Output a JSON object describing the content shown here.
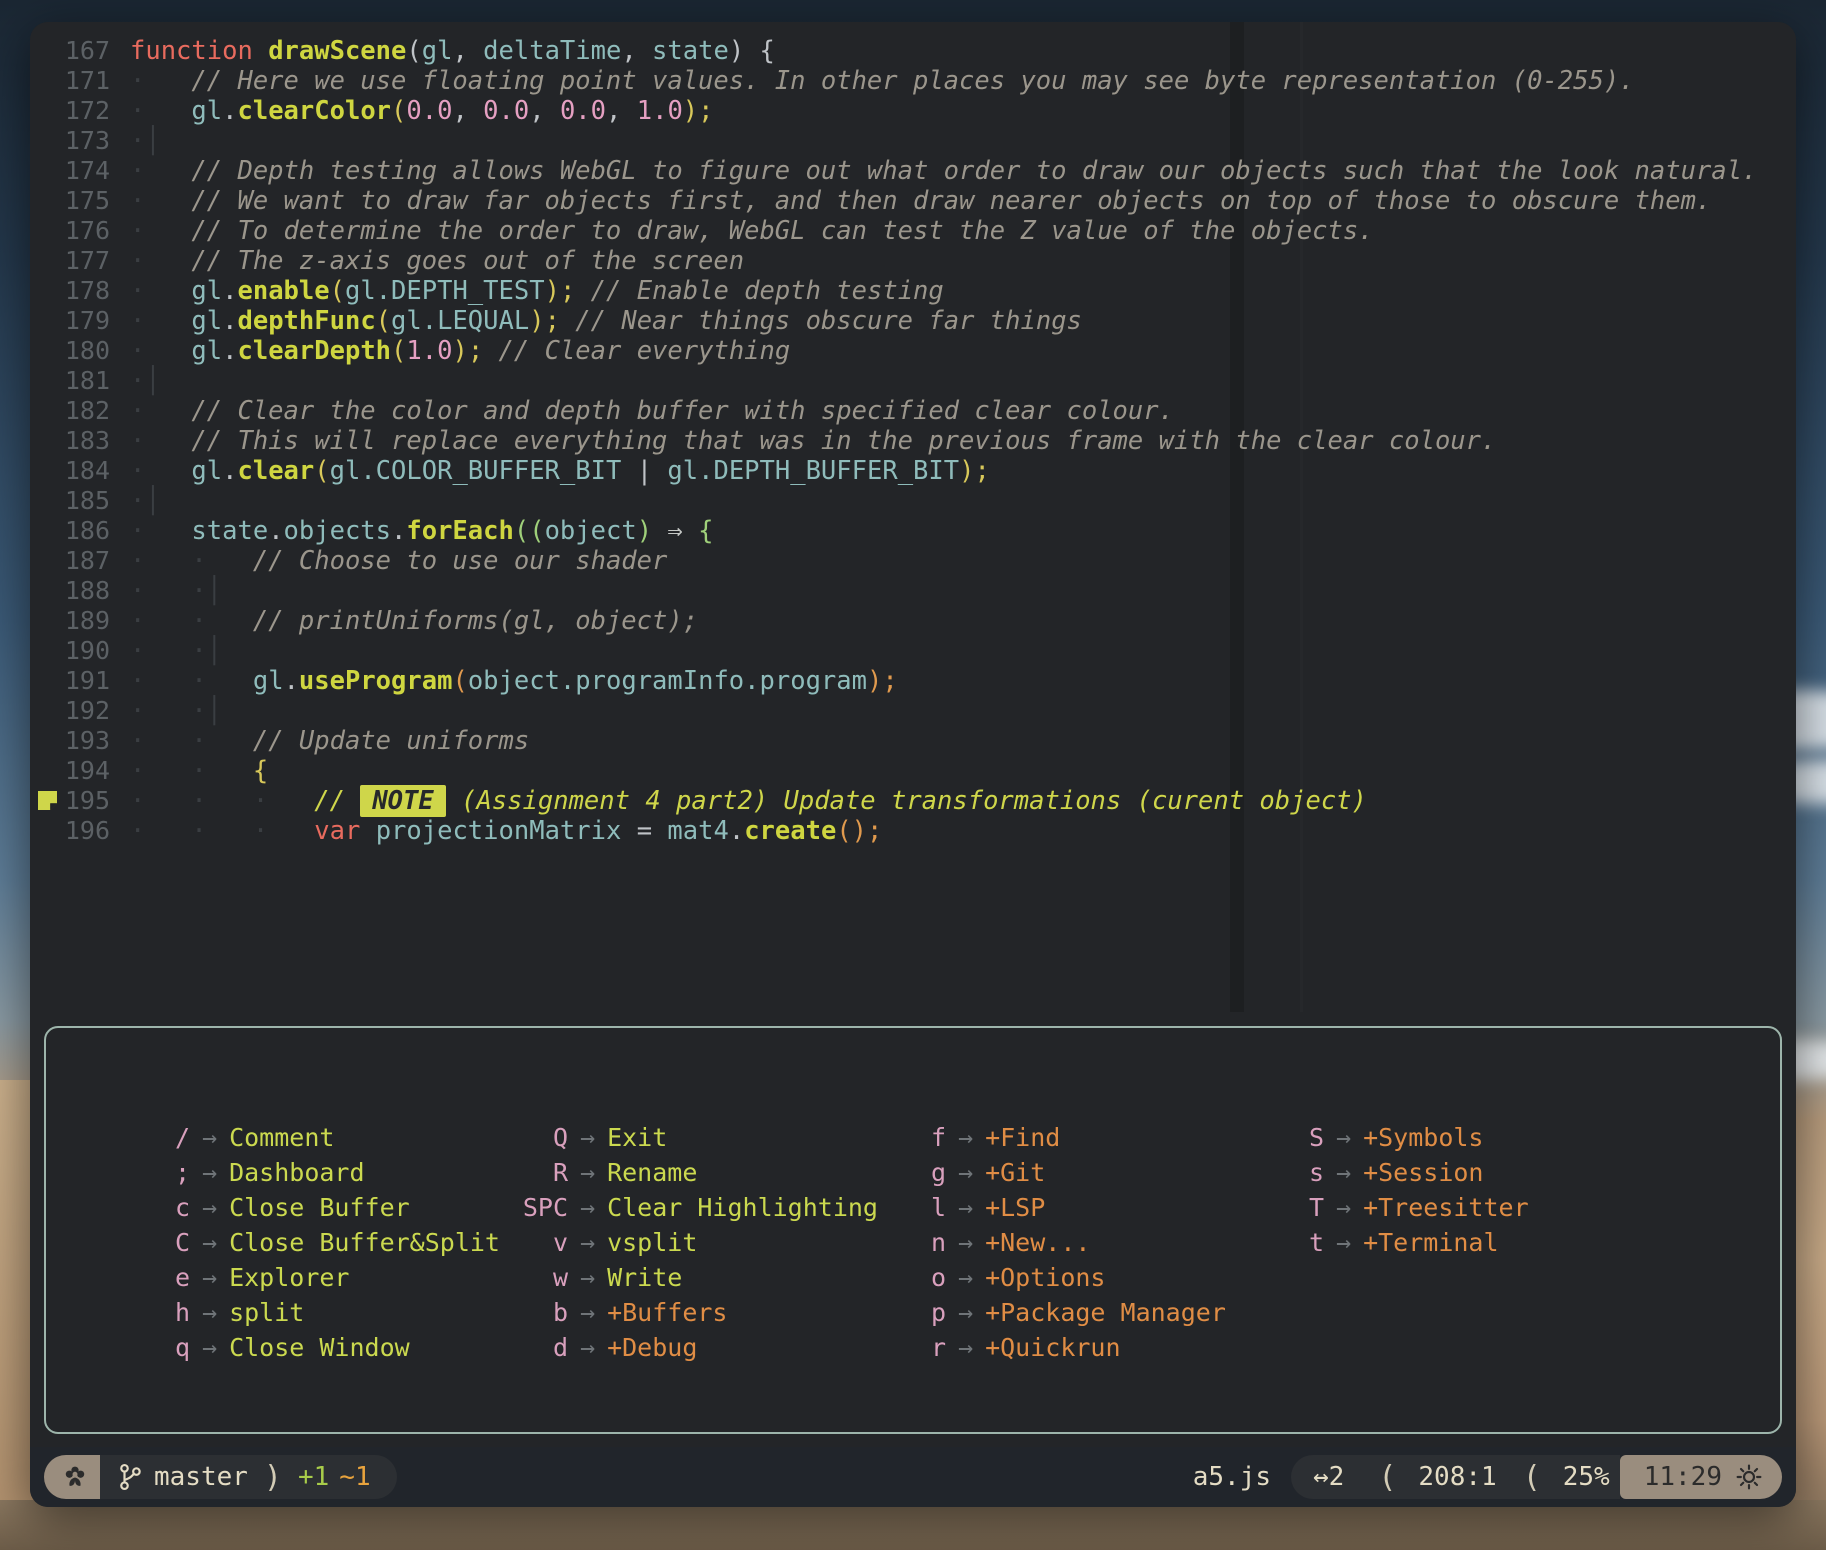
{
  "editor": {
    "code_lines": [
      {
        "num": "167",
        "indent": 0,
        "marker": null,
        "tokens": [
          {
            "c": "kw",
            "t": "function"
          },
          {
            "c": "op",
            "t": " "
          },
          {
            "c": "fn",
            "t": "drawScene"
          },
          {
            "c": "punc",
            "t": "("
          },
          {
            "c": "var",
            "t": "gl"
          },
          {
            "c": "punc",
            "t": ", "
          },
          {
            "c": "var",
            "t": "deltaTime"
          },
          {
            "c": "punc",
            "t": ", "
          },
          {
            "c": "var",
            "t": "state"
          },
          {
            "c": "punc",
            "t": ") {"
          }
        ]
      },
      {
        "num": "171",
        "indent": 1,
        "marker": null,
        "tokens": [
          {
            "c": "cmt",
            "t": "// Here we use floating point values. In other places you may see byte representation (0-255)."
          }
        ]
      },
      {
        "num": "172",
        "indent": 1,
        "marker": null,
        "tokens": [
          {
            "c": "var",
            "t": "gl"
          },
          {
            "c": "punc",
            "t": "."
          },
          {
            "c": "fn",
            "t": "clearColor"
          },
          {
            "c": "paren-y",
            "t": "("
          },
          {
            "c": "num",
            "t": "0.0"
          },
          {
            "c": "punc",
            "t": ", "
          },
          {
            "c": "num",
            "t": "0.0"
          },
          {
            "c": "punc",
            "t": ", "
          },
          {
            "c": "num",
            "t": "0.0"
          },
          {
            "c": "punc",
            "t": ", "
          },
          {
            "c": "num",
            "t": "1.0"
          },
          {
            "c": "paren-y",
            "t": ")"
          },
          {
            "c": "paren-y",
            "t": ";"
          }
        ]
      },
      {
        "num": "173",
        "indent": 1,
        "marker": null,
        "tokens": []
      },
      {
        "num": "174",
        "indent": 1,
        "marker": null,
        "tokens": [
          {
            "c": "cmt",
            "t": "// Depth testing allows WebGL to figure out what order to draw our objects such that the look natural."
          }
        ]
      },
      {
        "num": "175",
        "indent": 1,
        "marker": null,
        "tokens": [
          {
            "c": "cmt",
            "t": "// We want to draw far objects first, and then draw nearer objects on top of those to obscure them."
          }
        ]
      },
      {
        "num": "176",
        "indent": 1,
        "marker": null,
        "tokens": [
          {
            "c": "cmt",
            "t": "// To determine the order to draw, WebGL can test the Z value of the objects."
          }
        ]
      },
      {
        "num": "177",
        "indent": 1,
        "marker": null,
        "tokens": [
          {
            "c": "cmt",
            "t": "// The z-axis goes out of the screen"
          }
        ]
      },
      {
        "num": "178",
        "indent": 1,
        "marker": null,
        "tokens": [
          {
            "c": "var",
            "t": "gl"
          },
          {
            "c": "punc",
            "t": "."
          },
          {
            "c": "fn",
            "t": "enable"
          },
          {
            "c": "paren-y",
            "t": "("
          },
          {
            "c": "var",
            "t": "gl.DEPTH_TEST"
          },
          {
            "c": "paren-y",
            "t": ")"
          },
          {
            "c": "paren-y",
            "t": ";"
          },
          {
            "c": "op",
            "t": " "
          },
          {
            "c": "cmt",
            "t": "// Enable depth testing"
          }
        ]
      },
      {
        "num": "179",
        "indent": 1,
        "marker": null,
        "tokens": [
          {
            "c": "var",
            "t": "gl"
          },
          {
            "c": "punc",
            "t": "."
          },
          {
            "c": "fn",
            "t": "depthFunc"
          },
          {
            "c": "paren-y",
            "t": "("
          },
          {
            "c": "var",
            "t": "gl.LEQUAL"
          },
          {
            "c": "paren-y",
            "t": ")"
          },
          {
            "c": "paren-y",
            "t": ";"
          },
          {
            "c": "op",
            "t": " "
          },
          {
            "c": "cmt",
            "t": "// Near things obscure far things"
          }
        ]
      },
      {
        "num": "180",
        "indent": 1,
        "marker": null,
        "tokens": [
          {
            "c": "var",
            "t": "gl"
          },
          {
            "c": "punc",
            "t": "."
          },
          {
            "c": "fn",
            "t": "clearDepth"
          },
          {
            "c": "paren-y",
            "t": "("
          },
          {
            "c": "num",
            "t": "1.0"
          },
          {
            "c": "paren-y",
            "t": ")"
          },
          {
            "c": "paren-y",
            "t": ";"
          },
          {
            "c": "op",
            "t": " "
          },
          {
            "c": "cmt",
            "t": "// Clear everything"
          }
        ]
      },
      {
        "num": "181",
        "indent": 1,
        "marker": null,
        "tokens": []
      },
      {
        "num": "182",
        "indent": 1,
        "marker": null,
        "tokens": [
          {
            "c": "cmt",
            "t": "// Clear the color and depth buffer with specified clear colour."
          }
        ]
      },
      {
        "num": "183",
        "indent": 1,
        "marker": null,
        "tokens": [
          {
            "c": "cmt",
            "t": "// This will replace everything that was in the previous frame with the clear colour."
          }
        ]
      },
      {
        "num": "184",
        "indent": 1,
        "marker": null,
        "tokens": [
          {
            "c": "var",
            "t": "gl"
          },
          {
            "c": "punc",
            "t": "."
          },
          {
            "c": "fn",
            "t": "clear"
          },
          {
            "c": "paren-y",
            "t": "("
          },
          {
            "c": "var",
            "t": "gl.COLOR_BUFFER_BIT"
          },
          {
            "c": "op",
            "t": " "
          },
          {
            "c": "punc",
            "t": "|"
          },
          {
            "c": "op",
            "t": " "
          },
          {
            "c": "var",
            "t": "gl.DEPTH_BUFFER_BIT"
          },
          {
            "c": "paren-y",
            "t": ")"
          },
          {
            "c": "paren-y",
            "t": ";"
          }
        ]
      },
      {
        "num": "185",
        "indent": 1,
        "marker": null,
        "tokens": []
      },
      {
        "num": "186",
        "indent": 1,
        "marker": null,
        "tokens": [
          {
            "c": "var",
            "t": "state"
          },
          {
            "c": "punc",
            "t": "."
          },
          {
            "c": "var",
            "t": "objects"
          },
          {
            "c": "punc",
            "t": "."
          },
          {
            "c": "fn",
            "t": "forEach"
          },
          {
            "c": "paren-g",
            "t": "(("
          },
          {
            "c": "var",
            "t": "object"
          },
          {
            "c": "paren-g",
            "t": ")"
          },
          {
            "c": "op",
            "t": " ⇒ "
          },
          {
            "c": "paren-g",
            "t": "{"
          }
        ]
      },
      {
        "num": "187",
        "indent": 2,
        "marker": null,
        "tokens": [
          {
            "c": "cmt",
            "t": "// Choose to use our shader"
          }
        ]
      },
      {
        "num": "188",
        "indent": 2,
        "marker": null,
        "tokens": []
      },
      {
        "num": "189",
        "indent": 2,
        "marker": null,
        "tokens": [
          {
            "c": "cmt",
            "t": "// printUniforms(gl, object);"
          }
        ]
      },
      {
        "num": "190",
        "indent": 2,
        "marker": null,
        "tokens": []
      },
      {
        "num": "191",
        "indent": 2,
        "marker": null,
        "tokens": [
          {
            "c": "var",
            "t": "gl"
          },
          {
            "c": "punc",
            "t": "."
          },
          {
            "c": "fn",
            "t": "useProgram"
          },
          {
            "c": "paren-o",
            "t": "("
          },
          {
            "c": "var",
            "t": "object.programInfo.program"
          },
          {
            "c": "paren-o",
            "t": ")"
          },
          {
            "c": "paren-o",
            "t": ";"
          }
        ]
      },
      {
        "num": "192",
        "indent": 2,
        "marker": null,
        "tokens": []
      },
      {
        "num": "193",
        "indent": 2,
        "marker": null,
        "tokens": [
          {
            "c": "cmt",
            "t": "// Update uniforms"
          }
        ]
      },
      {
        "num": "194",
        "indent": 2,
        "marker": null,
        "tokens": [
          {
            "c": "paren-y",
            "t": "{"
          }
        ]
      },
      {
        "num": "195",
        "indent": 3,
        "marker": "note-sticky-icon",
        "tokens": [
          {
            "c": "note-cmt",
            "t": "// "
          },
          {
            "c": "note-badge",
            "t": "NOTE"
          },
          {
            "c": "note-cmt",
            "t": " (Assignment 4 part2) Update transformations (curent object)"
          }
        ]
      },
      {
        "num": "196",
        "indent": 3,
        "marker": null,
        "tokens": [
          {
            "c": "kw",
            "t": "var"
          },
          {
            "c": "op",
            "t": " "
          },
          {
            "c": "var",
            "t": "projectionMatrix"
          },
          {
            "c": "op",
            "t": " "
          },
          {
            "c": "punc",
            "t": "="
          },
          {
            "c": "op",
            "t": " "
          },
          {
            "c": "var",
            "t": "mat4"
          },
          {
            "c": "punc",
            "t": "."
          },
          {
            "c": "fn",
            "t": "create"
          },
          {
            "c": "paren-o",
            "t": "()"
          },
          {
            "c": "paren-o",
            "t": ";"
          }
        ]
      }
    ]
  },
  "whichkey": {
    "columns": [
      {
        "items": [
          {
            "key": "/",
            "label": "Comment",
            "group": false
          },
          {
            "key": ";",
            "label": "Dashboard",
            "group": false
          },
          {
            "key": "c",
            "label": "Close Buffer",
            "group": false
          },
          {
            "key": "C",
            "label": "Close Buffer&Split",
            "group": false
          },
          {
            "key": "e",
            "label": "Explorer",
            "group": false
          },
          {
            "key": "h",
            "label": "split",
            "group": false
          },
          {
            "key": "q",
            "label": "Close Window",
            "group": false
          }
        ]
      },
      {
        "items": [
          {
            "key": "Q",
            "label": "Exit",
            "group": false
          },
          {
            "key": "R",
            "label": "Rename",
            "group": false
          },
          {
            "key": "SPC",
            "label": "Clear Highlighting",
            "group": false
          },
          {
            "key": "v",
            "label": "vsplit",
            "group": false
          },
          {
            "key": "w",
            "label": "Write",
            "group": false
          },
          {
            "key": "b",
            "label": "+Buffers",
            "group": true
          },
          {
            "key": "d",
            "label": "+Debug",
            "group": true
          }
        ]
      },
      {
        "items": [
          {
            "key": "f",
            "label": "+Find",
            "group": true
          },
          {
            "key": "g",
            "label": "+Git",
            "group": true
          },
          {
            "key": "l",
            "label": "+LSP",
            "group": true
          },
          {
            "key": "n",
            "label": "+New...",
            "group": true
          },
          {
            "key": "o",
            "label": "+Options",
            "group": true
          },
          {
            "key": "p",
            "label": "+Package Manager",
            "group": true
          },
          {
            "key": "r",
            "label": "+Quickrun",
            "group": true
          }
        ]
      },
      {
        "items": [
          {
            "key": "S",
            "label": "+Symbols",
            "group": true
          },
          {
            "key": "s",
            "label": "+Session",
            "group": true
          },
          {
            "key": "T",
            "label": "+Treesitter",
            "group": true
          },
          {
            "key": "t",
            "label": "+Terminal",
            "group": true
          }
        ]
      }
    ],
    "arrow": "→"
  },
  "statusbar": {
    "mode_icon": "flower-icon",
    "branch_icon": "git-branch-icon",
    "branch": "master",
    "separator": ")",
    "git_added": "+1",
    "git_changed": "~1",
    "filename": "a5.js",
    "buffers": "↔2",
    "sep_left_1": "(",
    "position": "208:1",
    "sep_left_2": "(",
    "progress": "25%",
    "time": "11:29",
    "time_icon": "sun-icon"
  },
  "colors": {
    "background": "#232528",
    "window_chrome": "#21252b",
    "keyword": "#e86b5e",
    "function": "#cfd640",
    "variable": "#8fbcbb",
    "number": "#e5a0c2",
    "comment": "#9b968c",
    "note_badge_bg": "#cfd64a",
    "whichkey_key": "#d9a0bd",
    "whichkey_label": "#cbd94f",
    "whichkey_group": "#e08d45",
    "popup_border": "#9db5ab",
    "status_accent": "#9a8d7e",
    "git_added": "#a8cc4a",
    "git_changed": "#e8a33d"
  }
}
